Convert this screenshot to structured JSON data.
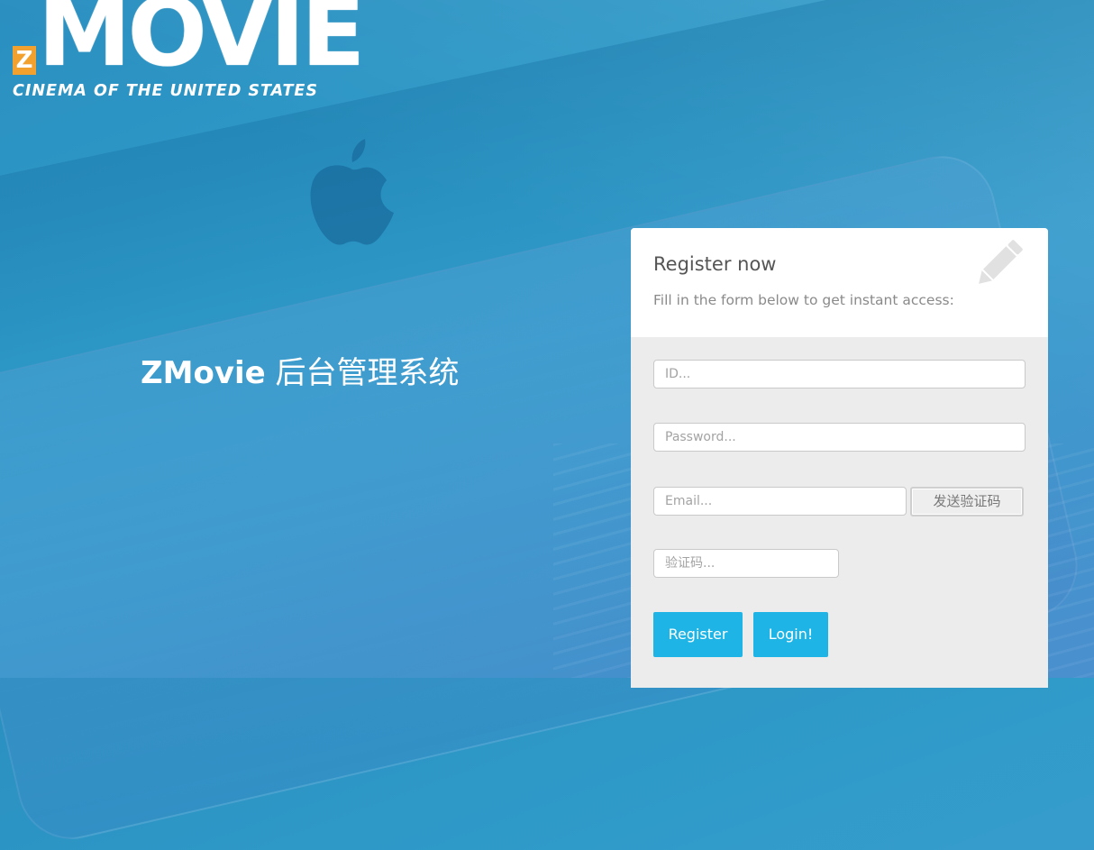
{
  "logo": {
    "word": "MOVIE",
    "badge": "Z",
    "tagline": "CINEMA OF THE UNITED STATES"
  },
  "system_title": {
    "brand": "ZMovie",
    "subtitle": " 后台管理系统"
  },
  "register_card": {
    "title": "Register now",
    "subtitle": "Fill in the form below to get instant access:",
    "icon": "pencil-icon",
    "fields": {
      "id_placeholder": "ID...",
      "password_placeholder": "Password...",
      "email_placeholder": "Email...",
      "code_placeholder": "验证码..."
    },
    "send_code_label": "发送验证码",
    "register_label": "Register",
    "login_label": "Login!"
  },
  "colors": {
    "accent": "#1fb4e6",
    "logo_badge": "#f2a12e",
    "background": "#2f9bc9"
  }
}
